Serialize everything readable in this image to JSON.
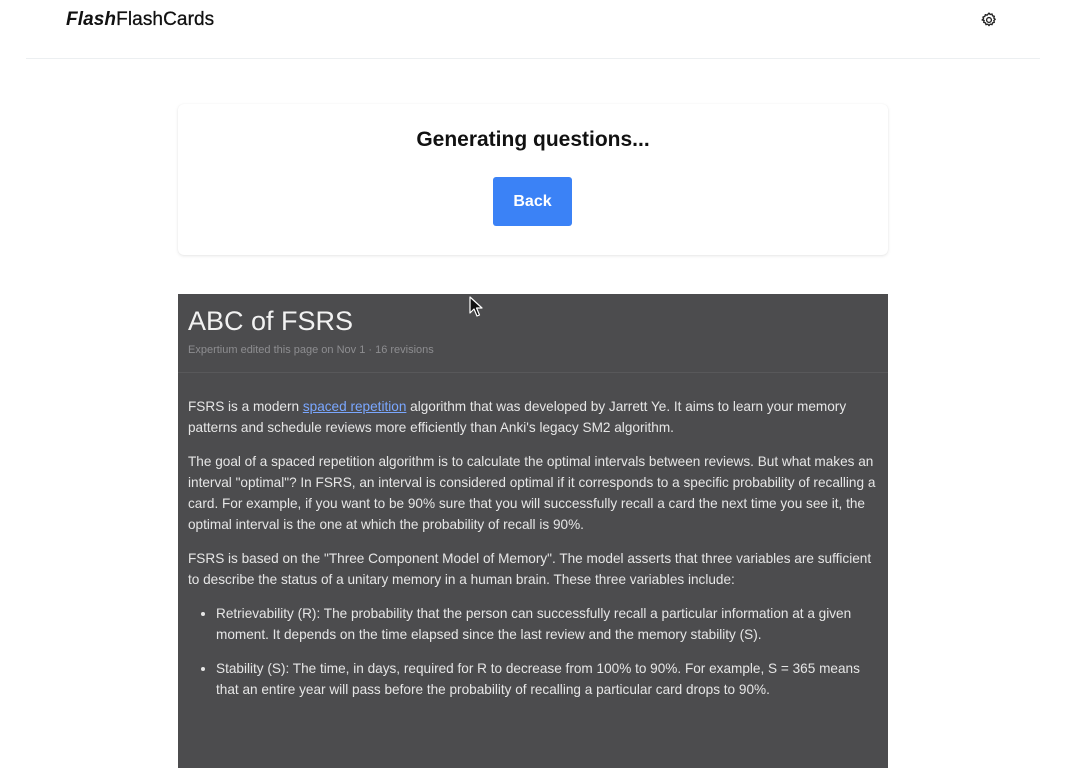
{
  "header": {
    "brand_italic": "Flash",
    "brand_rest": "FlashCards",
    "settings_icon": "gear-icon"
  },
  "status_card": {
    "title": "Generating questions...",
    "back_label": "Back",
    "back_color": "#3b82f6"
  },
  "document": {
    "title": "ABC of FSRS",
    "meta": "Expertium edited this page on Nov 1 · 16 revisions",
    "p1_before": "FSRS is a modern ",
    "p1_link": "spaced repetition",
    "p1_after": " algorithm that was developed by Jarrett Ye. It aims to learn your memory patterns and schedule reviews more efficiently than Anki's legacy SM2 algorithm.",
    "p2": "The goal of a spaced repetition algorithm is to calculate the optimal intervals between reviews. But what makes an interval \"optimal\"? In FSRS, an interval is considered optimal if it corresponds to a specific probability of recalling a card. For example, if you want to be 90% sure that you will successfully recall a card the next time you see it, the optimal interval is the one at which the probability of recall is 90%.",
    "p3": "FSRS is based on the \"Three Component Model of Memory\". The model asserts that three variables are sufficient to describe the status of a unitary memory in a human brain. These three variables include:",
    "bullets": [
      "Retrievability (R): The probability that the person can successfully recall a particular information at a given moment. It depends on the time elapsed since the last review and the memory stability (S).",
      "Stability (S): The time, in days, required for R to decrease from 100% to 90%. For example, S = 365 means that an entire year will pass before the probability of recalling a particular card drops to 90%."
    ],
    "background": "#4c4c4e"
  }
}
